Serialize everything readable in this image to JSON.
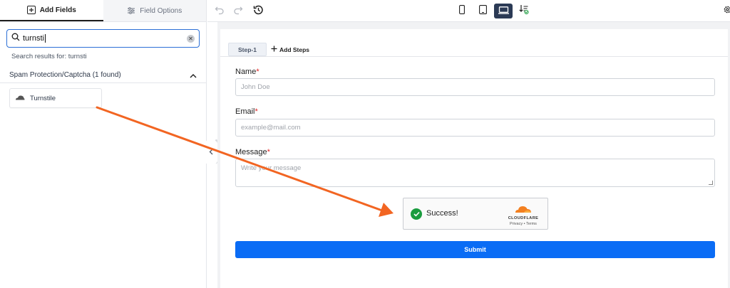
{
  "panel_tabs": {
    "add_fields": "Add Fields",
    "field_options": "Field Options"
  },
  "search": {
    "value": "turnsti",
    "results_label": "Search results for: turnsti"
  },
  "category": {
    "title": "Spam Protection/Captcha (1 found)",
    "fields": [
      "Turnstile"
    ]
  },
  "toolbar": {
    "icons": [
      "undo-icon",
      "redo-icon",
      "history-icon",
      "mobile-icon",
      "tablet-icon",
      "desktop-icon",
      "export-icon",
      "settings-icon"
    ],
    "active_device": "desktop"
  },
  "steps": {
    "current": "Step-1",
    "add": "Add Steps"
  },
  "form": {
    "name": {
      "label": "Name",
      "required_mark": "*",
      "placeholder": "John Doe"
    },
    "email": {
      "label": "Email",
      "required_mark": "*",
      "placeholder": "example@mail.com"
    },
    "message": {
      "label": "Message",
      "required_mark": "*",
      "placeholder": "Write your message"
    },
    "captcha": {
      "status": "Success!",
      "brand": "CLOUDFLARE",
      "links": "Privacy • Terms"
    },
    "submit": "Submit"
  },
  "colors": {
    "accent": "#0a6cf5",
    "arrow": "#f26522",
    "success": "#1a9c3e",
    "cloudflare": "#f38020"
  }
}
